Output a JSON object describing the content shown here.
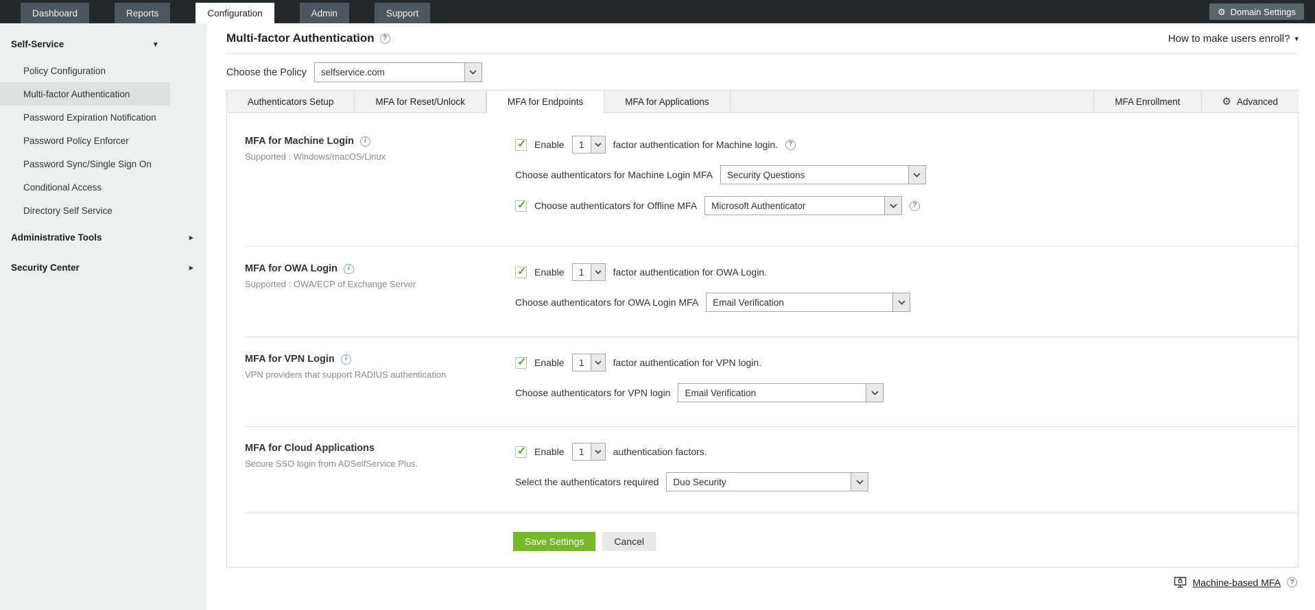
{
  "topnav": {
    "items": [
      "Dashboard",
      "Reports",
      "Configuration",
      "Admin",
      "Support"
    ],
    "active": "Configuration",
    "domain_settings_label": "Domain Settings"
  },
  "sidebar": {
    "groups": [
      {
        "label": "Self-Service",
        "expanded": true,
        "items": [
          "Policy Configuration",
          "Multi-factor Authentication",
          "Password Expiration Notification",
          "Password Policy Enforcer",
          "Password Sync/Single Sign On",
          "Conditional Access",
          "Directory Self Service"
        ]
      },
      {
        "label": "Administrative Tools",
        "expanded": false,
        "items": []
      },
      {
        "label": "Security Center",
        "expanded": false,
        "items": []
      }
    ],
    "active_item": "Multi-factor Authentication"
  },
  "header": {
    "title": "Multi-factor Authentication",
    "enroll_link": "How to make users enroll?"
  },
  "policy": {
    "label": "Choose the Policy",
    "value": "selfservice.com"
  },
  "tabs": {
    "items": [
      "Authenticators Setup",
      "MFA for Reset/Unlock",
      "MFA for Endpoints",
      "MFA for Applications"
    ],
    "active": "MFA for Endpoints",
    "right_items": [
      "MFA Enrollment",
      "Advanced"
    ]
  },
  "sections": [
    {
      "title": "MFA for Machine Login",
      "subtitle": "Supported : Windows/macOS/Linux",
      "enable": {
        "checked": true,
        "label": "Enable",
        "factor_value": "1",
        "text_after": "factor authentication for Machine login."
      },
      "auth_rows": [
        {
          "label": "Choose authenticators for Machine Login MFA",
          "value": "Security Questions"
        },
        {
          "label": "Choose authenticators for Offline MFA",
          "value": "Microsoft Authenticator",
          "checked": true
        }
      ]
    },
    {
      "title": "MFA for OWA Login",
      "subtitle": "Supported : OWA/ECP of Exchange Server",
      "enable": {
        "checked": true,
        "label": "Enable",
        "factor_value": "1",
        "text_after": "factor authentication for OWA Login."
      },
      "auth_rows": [
        {
          "label": "Choose authenticators for OWA Login MFA",
          "value": "Email Verification"
        }
      ]
    },
    {
      "title": "MFA for VPN Login",
      "subtitle": "VPN providers that support RADIUS authentication",
      "enable": {
        "checked": true,
        "label": "Enable",
        "factor_value": "1",
        "text_after": "factor authentication for VPN login."
      },
      "auth_rows": [
        {
          "label": "Choose authenticators for VPN login",
          "value": "Email Verification"
        }
      ]
    },
    {
      "title": "MFA for Cloud Applications",
      "subtitle": "Secure SSO login from ADSelfService Plus.",
      "enable": {
        "checked": true,
        "label": "Enable",
        "factor_value": "1",
        "text_after": "authentication factors."
      },
      "auth_rows": [
        {
          "label": "Select the authenticators required",
          "value": "Duo Security"
        }
      ]
    }
  ],
  "buttons": {
    "save_label": "Save Settings",
    "cancel_label": "Cancel"
  },
  "footer": {
    "machine_mfa_label": "Machine-based MFA"
  },
  "icons": {
    "gear": "⚙",
    "caret_down": "▾",
    "caret_right": "▸",
    "check": "✓",
    "info": "i",
    "help": "?"
  },
  "colors": {
    "nav_bar": "#23282b",
    "nav_item": "#4c565e",
    "domain_btn": "#59646b",
    "sidebar_bg": "#edf0f1",
    "active_item_bg": "#dee1e2",
    "tab_strip": "#f1f1f2",
    "save_green": "#76b82a",
    "check_green": "#4cae2c",
    "info_blue": "#4f87c7"
  }
}
